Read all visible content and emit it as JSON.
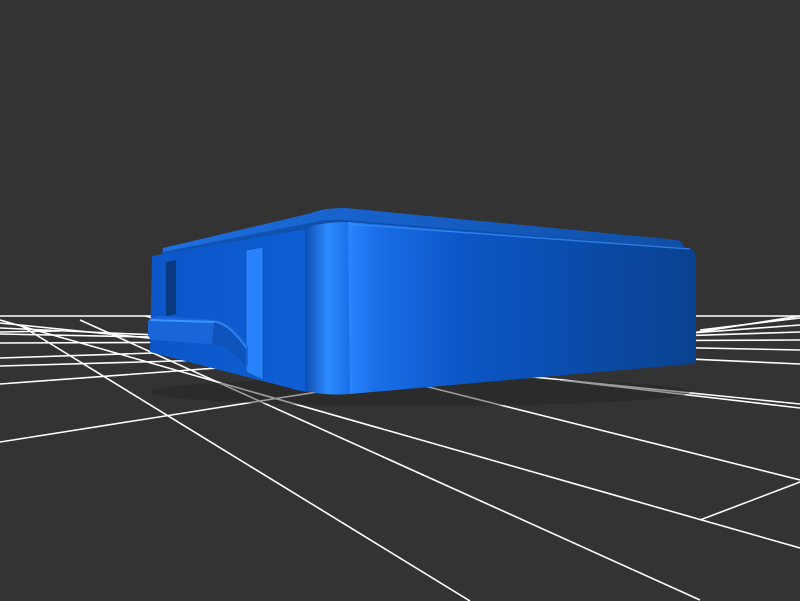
{
  "viewport": {
    "background_color": "#333333",
    "grid_color": "#ffffff",
    "model_color": "#1a66d9",
    "model_highlight_color": "#2a86ff",
    "model_shadow_color": "#0a3f8a",
    "grid_visible": true
  },
  "model": {
    "shape": "rounded rectangular enclosure with lid lip",
    "icon": "3d-box-model"
  }
}
